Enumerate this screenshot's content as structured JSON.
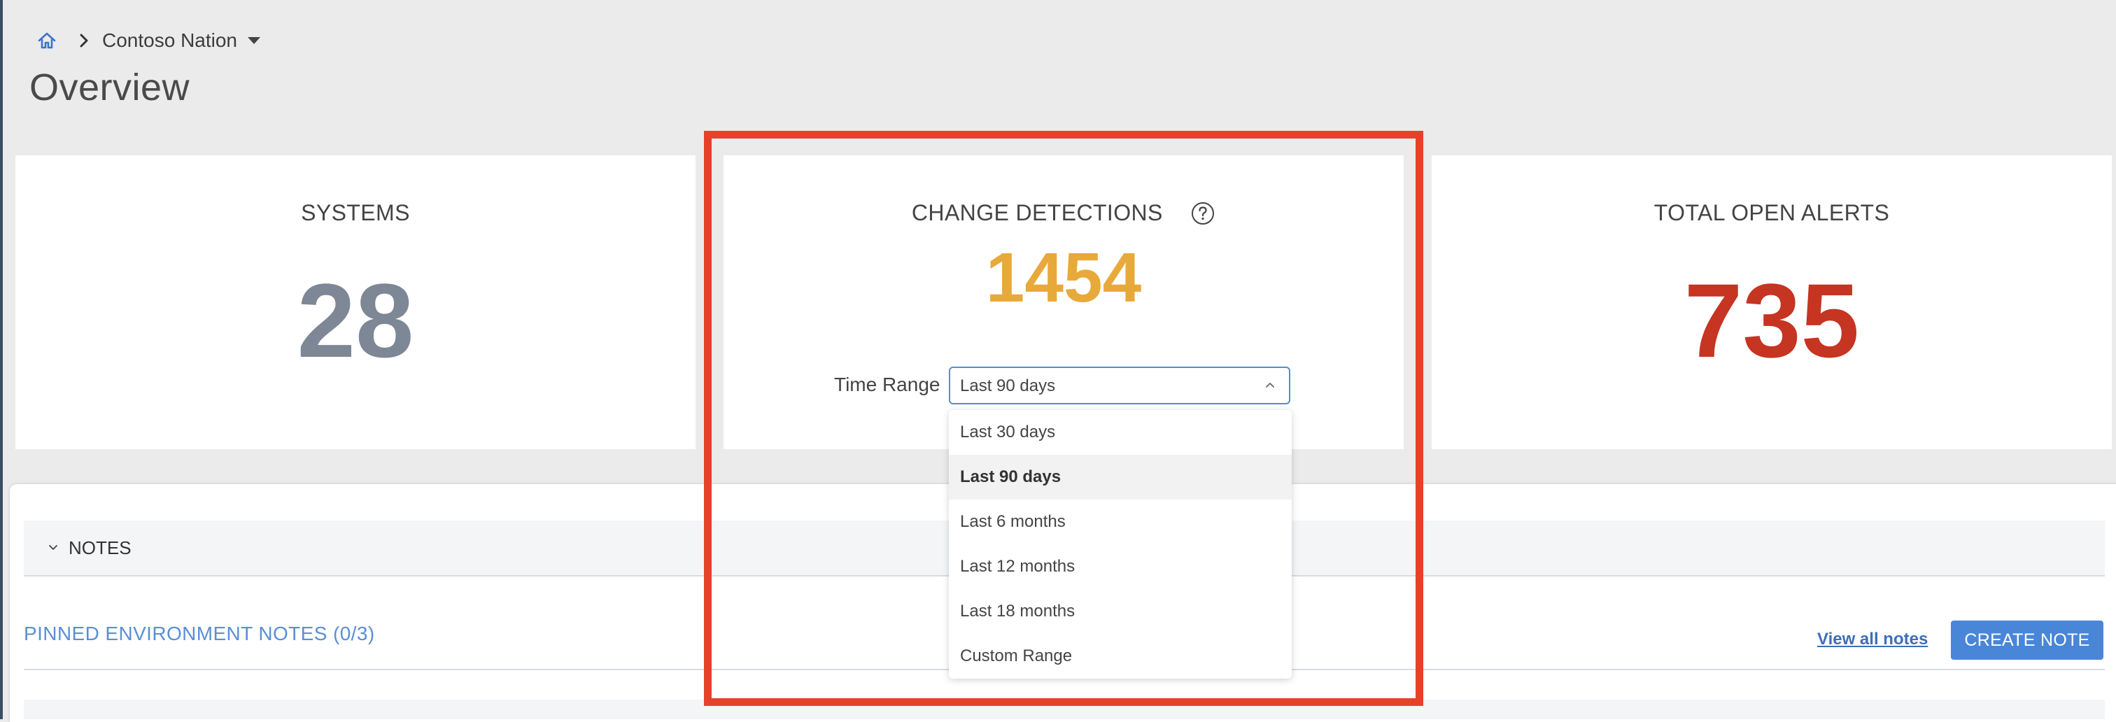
{
  "breadcrumb": {
    "home_icon": "home-icon",
    "separator_icon": "chevron-right-icon",
    "current": "Contoso Nation",
    "dropdown_icon": "caret-down-icon"
  },
  "page_title": "Overview",
  "cards": {
    "systems": {
      "title": "SYSTEMS",
      "value": "28",
      "color": "#7d8796"
    },
    "change_detections": {
      "title": "CHANGE DETECTIONS",
      "help_icon": "question-circle-icon",
      "value": "1454",
      "color": "#e8a93b",
      "time_range_label": "Time Range",
      "time_range_selected": "Last 90 days"
    },
    "alerts": {
      "title": "TOTAL OPEN ALERTS",
      "value": "735",
      "color": "#c63422"
    }
  },
  "dropdown": {
    "options": [
      "Last 30 days",
      "Last 90 days",
      "Last 6 months",
      "Last 12 months",
      "Last 18 months",
      "Custom Range"
    ],
    "selected_index": 1
  },
  "notes": {
    "section_label": "NOTES",
    "pinned_title": "PINNED ENVIRONMENT NOTES (0/3)",
    "view_all_link": "View all notes",
    "create_button": "CREATE NOTE"
  },
  "colors": {
    "accent": "#4a86d8",
    "highlight": "#e8412a",
    "background": "#ebebeb"
  }
}
